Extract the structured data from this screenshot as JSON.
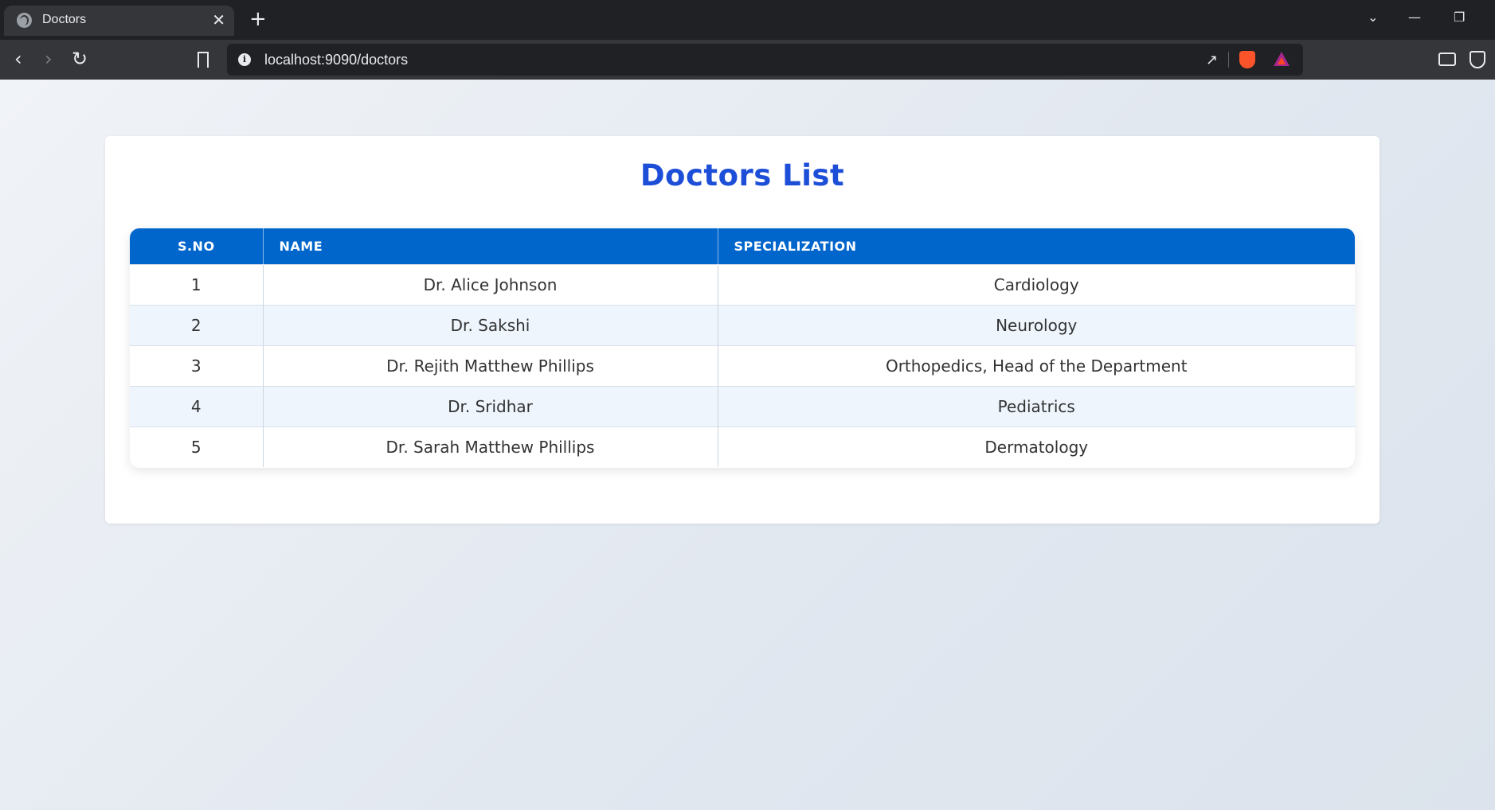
{
  "browser": {
    "tab_title": "Doctors",
    "tab_close": "✕",
    "new_tab": "+",
    "url": "localhost:9090/doctors",
    "window_controls": {
      "dropdown": "⌄",
      "minimize": "—",
      "restore": "❐"
    }
  },
  "page": {
    "title": "Doctors List",
    "table": {
      "headers": [
        "S.NO",
        "NAME",
        "SPECIALIZATION"
      ],
      "rows": [
        [
          "1",
          "Dr. Alice Johnson",
          "Cardiology"
        ],
        [
          "2",
          "Dr. Sakshi",
          "Neurology"
        ],
        [
          "3",
          "Dr. Rejith Matthew Phillips",
          "Orthopedics, Head of the Department"
        ],
        [
          "4",
          "Dr. Sridhar",
          "Pediatrics"
        ],
        [
          "5",
          "Dr. Sarah Matthew Phillips",
          "Dermatology"
        ]
      ]
    }
  },
  "colors": {
    "title": "#1d4ed8",
    "header_bg": "#0066cc",
    "row_alt": "#eef5fd"
  }
}
